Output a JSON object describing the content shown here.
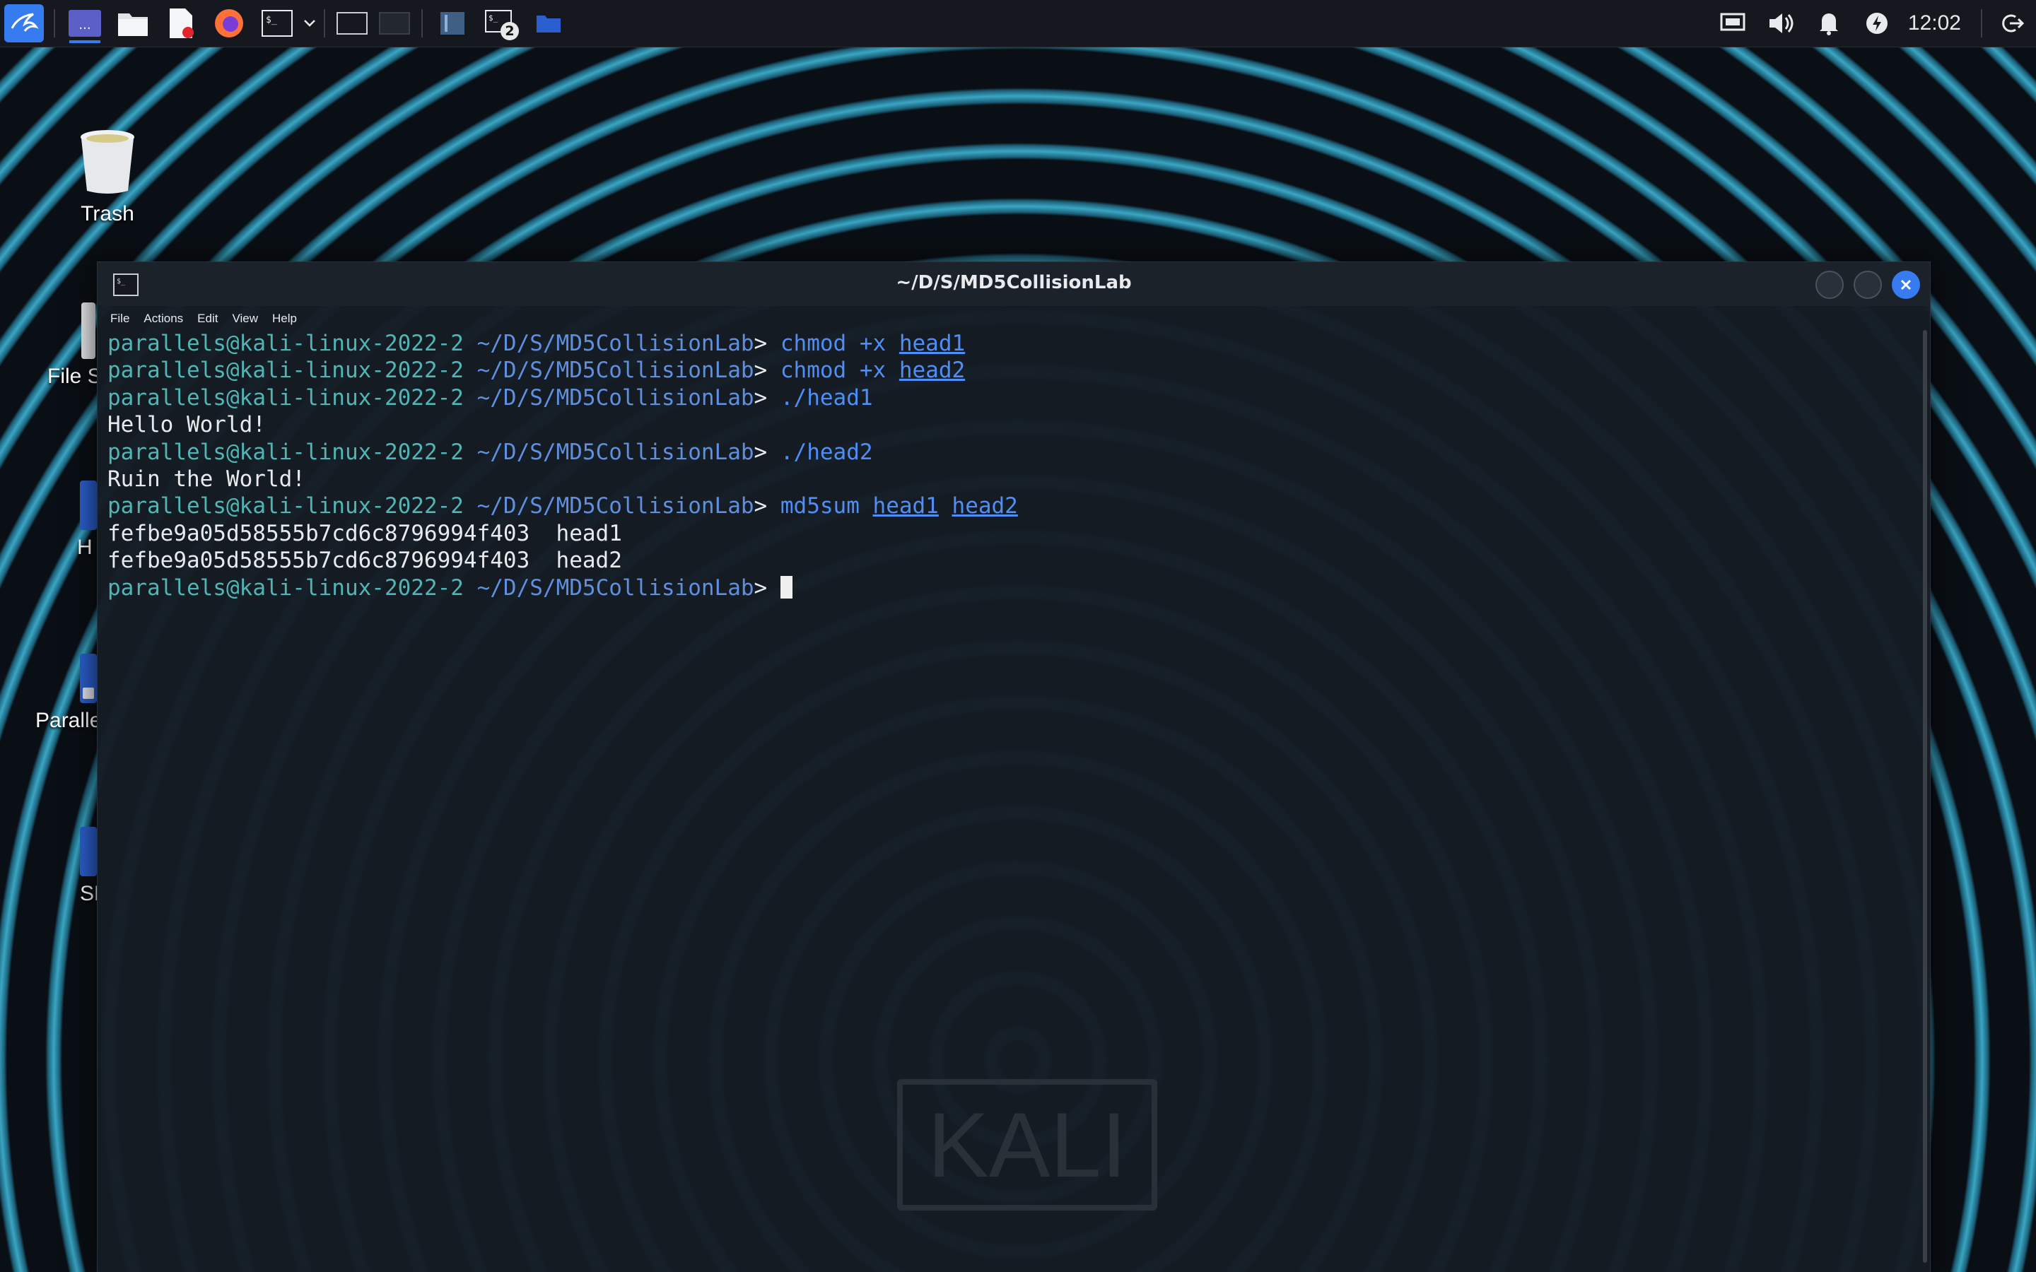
{
  "panel": {
    "clock": "12:02",
    "taskbar_badge": "2"
  },
  "desktop": {
    "icons": [
      {
        "label": "Trash"
      },
      {
        "label": "File S"
      },
      {
        "label": "H"
      },
      {
        "label": "Parallels S..."
      },
      {
        "label": "SEED"
      }
    ]
  },
  "terminal": {
    "title": "~/D/S/MD5CollisionLab",
    "menu": [
      "File",
      "Actions",
      "Edit",
      "View",
      "Help"
    ],
    "prompt": {
      "user": "parallels",
      "at": "@",
      "host": "kali-linux-2022-2",
      "path": " ~/D/S/MD5CollisionLab",
      "arrow": "> "
    },
    "lines": [
      {
        "type": "cmd",
        "cmd": "chmod +x ",
        "args": [
          "head1"
        ]
      },
      {
        "type": "cmd",
        "cmd": "chmod +x ",
        "args": [
          "head2"
        ]
      },
      {
        "type": "cmd",
        "cmd": "./head1",
        "args": []
      },
      {
        "type": "out",
        "text": "Hello World!"
      },
      {
        "type": "cmd",
        "cmd": "./head2",
        "args": []
      },
      {
        "type": "out",
        "text": "Ruin the World!"
      },
      {
        "type": "cmd",
        "cmd": "md5sum ",
        "args": [
          "head1",
          "head2"
        ]
      },
      {
        "type": "out",
        "text": "fefbe9a05d58555b7cd6c8796994f403  head1"
      },
      {
        "type": "out",
        "text": "fefbe9a05d58555b7cd6c8796994f403  head2"
      },
      {
        "type": "prompt"
      }
    ],
    "watermark": "KALI"
  },
  "colors": {
    "accent": "#367bf0",
    "prompt_user": "#4fb5b5",
    "prompt_path": "#5f8fe0",
    "command": "#4f8ef7"
  }
}
